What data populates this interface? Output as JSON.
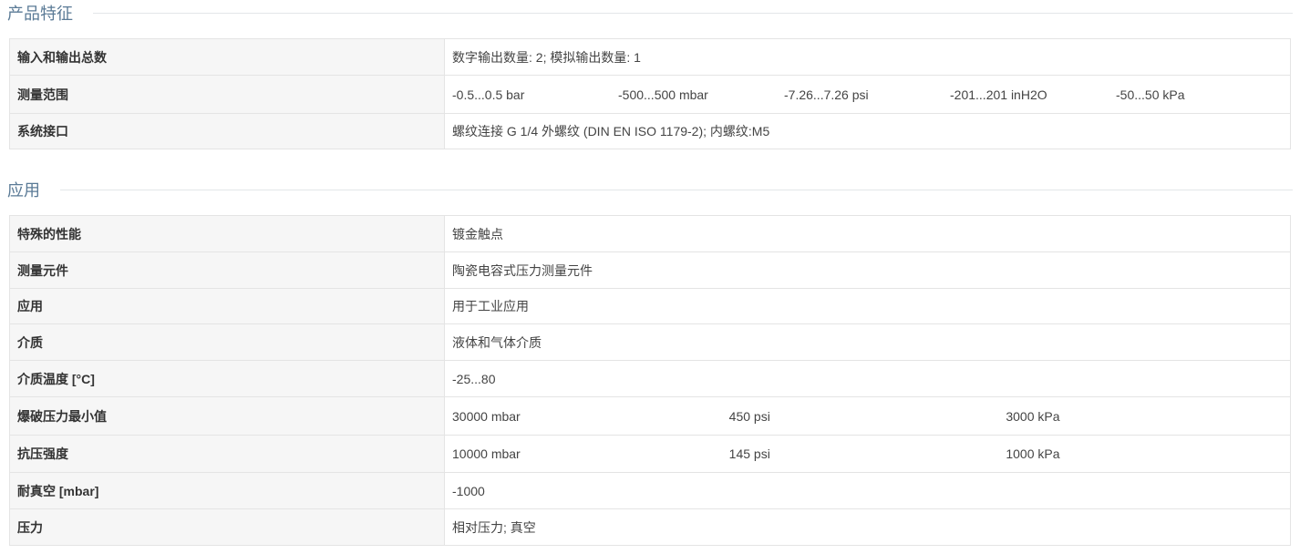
{
  "sections": [
    {
      "title": "产品特征",
      "rows": [
        {
          "label": "输入和输出总数",
          "value": "数字输出数量: 2; 模拟输出数量: 1"
        },
        {
          "label": "测量范围",
          "values": [
            "-0.5...0.5 bar",
            "-500...500 mbar",
            "-7.26...7.26 psi",
            "-201...201 inH2O",
            "-50...50 kPa"
          ]
        },
        {
          "label": "系统接口",
          "value": "螺纹连接 G 1/4 外螺纹 (DIN EN ISO 1179-2); 内螺纹:M5"
        }
      ]
    },
    {
      "title": "应用",
      "rows": [
        {
          "label": "特殊的性能",
          "value": "镀金触点"
        },
        {
          "label": "测量元件",
          "value": "陶瓷电容式压力测量元件"
        },
        {
          "label": "应用",
          "value": "用于工业应用"
        },
        {
          "label": "介质",
          "value": "液体和气体介质"
        },
        {
          "label": "介质温度 [°C]",
          "value": "-25...80"
        },
        {
          "label": "爆破压力最小值",
          "values": [
            "30000 mbar",
            "450 psi",
            "3000 kPa"
          ]
        },
        {
          "label": "抗压强度",
          "values": [
            "10000 mbar",
            "145 psi",
            "1000 kPa"
          ]
        },
        {
          "label": "耐真空 [mbar]",
          "value": "-1000"
        },
        {
          "label": "压力",
          "value": "相对压力; 真空"
        }
      ]
    }
  ]
}
